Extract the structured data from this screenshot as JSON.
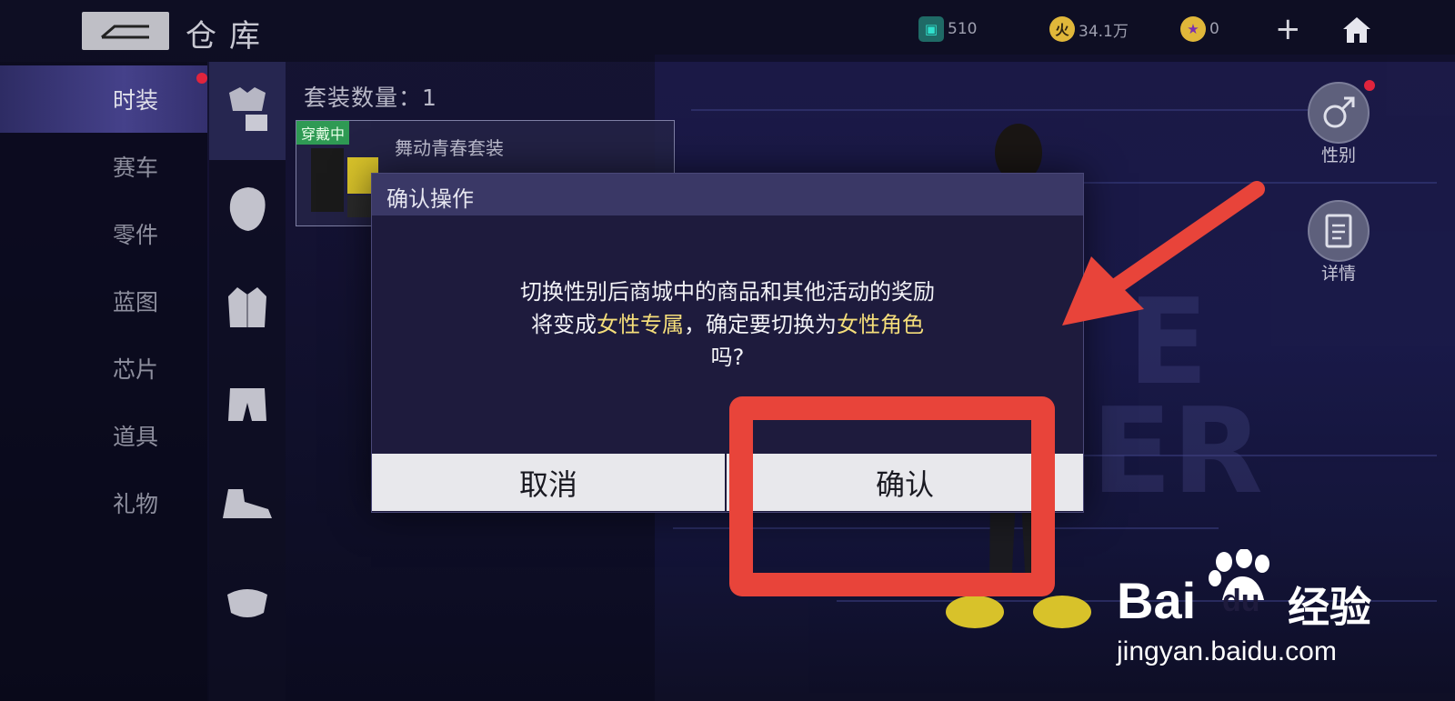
{
  "window": {
    "title": "仓库"
  },
  "topbar": {
    "resources": [
      {
        "icon": "coupon-icon",
        "value": "510",
        "color": "#2fb7a8"
      },
      {
        "icon": "coin-icon",
        "value": "34.1万",
        "color": "#e0b73a"
      },
      {
        "icon": "star-coin-icon",
        "value": "0",
        "color": "#e0b73a"
      }
    ],
    "plus": "+"
  },
  "left_nav": {
    "items": [
      {
        "label": "时装",
        "active": true
      },
      {
        "label": "赛车"
      },
      {
        "label": "零件"
      },
      {
        "label": "蓝图"
      },
      {
        "label": "芯片"
      },
      {
        "label": "道具"
      },
      {
        "label": "礼物"
      }
    ]
  },
  "sub_nav": {
    "items": [
      {
        "icon": "suit-icon"
      },
      {
        "icon": "hair-icon"
      },
      {
        "icon": "jacket-icon"
      },
      {
        "icon": "shorts-icon"
      },
      {
        "icon": "shoes-icon"
      },
      {
        "icon": "mask-icon"
      }
    ]
  },
  "content": {
    "suit_count_label": "套装数量：1",
    "suit_card": {
      "badge": "穿戴中",
      "name": "舞动青春套装"
    }
  },
  "side_buttons": {
    "gender_label": "性别",
    "details_label": "详情"
  },
  "dialog": {
    "title": "确认操作",
    "message_parts": {
      "p1": "切换性别后商城中的商品和其他活动的奖励",
      "p2": "将变成",
      "h1": "女性专属",
      "p3": "，确定要切换为",
      "h2": "女性角色",
      "p4": "吗?"
    },
    "cancel_label": "取消",
    "confirm_label": "确认"
  },
  "watermark": {
    "brand": "Bai",
    "brand_du": "du",
    "brand_cn": "经验",
    "url": "jingyan.baidu.com"
  },
  "colors": {
    "highlight": "#f5de7a",
    "annotation": "#e8443a",
    "nav_active": "#3e3a80"
  }
}
